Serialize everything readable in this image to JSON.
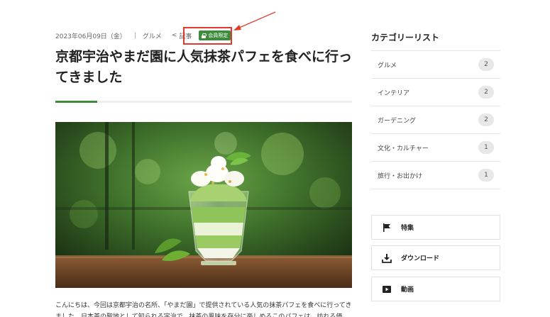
{
  "article": {
    "date": "2023年06月09日（金）",
    "category": "グルメ",
    "breadcrumb_marker": "<",
    "breadcrumb_label": "記事",
    "member_badge": "会員限定",
    "title": "京都宇治やまだ園に人気抹茶パフェを食べに行ってきました",
    "intro": "こんにちは、今回は京都宇治の名所、「やまだ園」で提供されている人気の抹茶パフェを食べに行ってきました。日本茶の聖地として知られる宇治で、抹茶の風味を存分に楽しめるこのパフェは、訪れる価"
  },
  "sidebar": {
    "category_heading": "カテゴリーリスト",
    "categories": [
      {
        "label": "グルメ",
        "count": "2"
      },
      {
        "label": "インテリア",
        "count": "2"
      },
      {
        "label": "ガーデニング",
        "count": "2"
      },
      {
        "label": "文化・カルチャー",
        "count": "1"
      },
      {
        "label": "旅行・お出かけ",
        "count": "1"
      }
    ],
    "links": [
      {
        "label": "特集",
        "icon": "flag-icon"
      },
      {
        "label": "ダウンロード",
        "icon": "download-icon"
      },
      {
        "label": "動画",
        "icon": "video-icon"
      }
    ]
  },
  "colors": {
    "accent_green": "#3c8c3c",
    "annotation_red": "#e03a2f"
  }
}
